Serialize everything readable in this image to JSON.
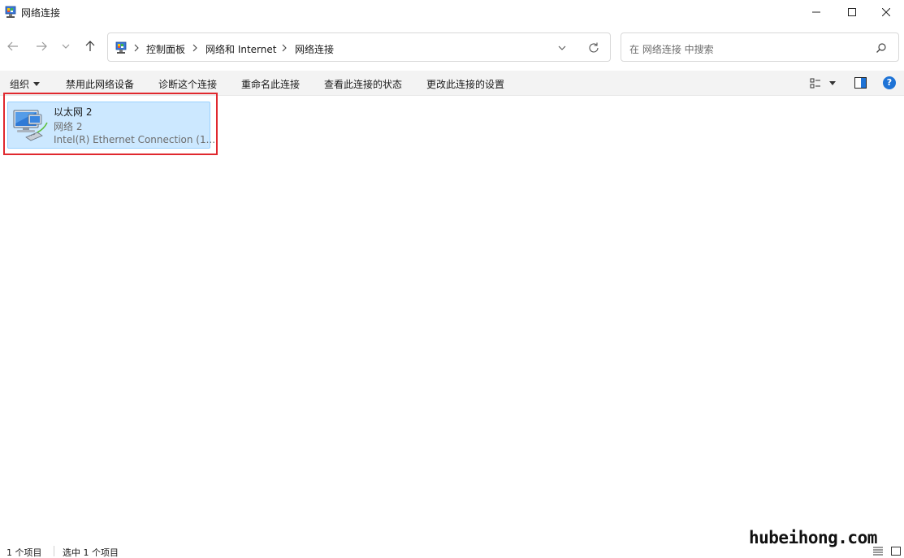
{
  "window": {
    "title": "网络连接",
    "app_icon": "network-connections-icon",
    "controls": [
      "minimize-icon",
      "maximize-icon",
      "close-icon"
    ]
  },
  "address_bar": {
    "location_icon": "control-panel-icon",
    "breadcrumbs": [
      "控制面板",
      "网络和 Internet",
      "网络连接"
    ]
  },
  "search": {
    "placeholder": "在 网络连接 中搜索"
  },
  "command_bar": {
    "organize": "组织",
    "disable": "禁用此网络设备",
    "diagnose": "诊断这个连接",
    "rename": "重命名此连接",
    "status": "查看此连接的状态",
    "settings": "更改此连接的设置"
  },
  "items": [
    {
      "name": "以太网 2",
      "network": "网络 2",
      "device": "Intel(R) Ethernet Connection (1...",
      "icon": "ethernet-adapter-icon",
      "selected": true
    }
  ],
  "status_bar": {
    "count": "1 个项目",
    "selected": "选中 1 个项目"
  },
  "watermark": "hubeihong.com",
  "colors": {
    "selection_fill": "#cce8ff",
    "selection_border": "#99d1ff",
    "highlight_box": "#e0282e",
    "help_blue": "#1e73d6"
  }
}
